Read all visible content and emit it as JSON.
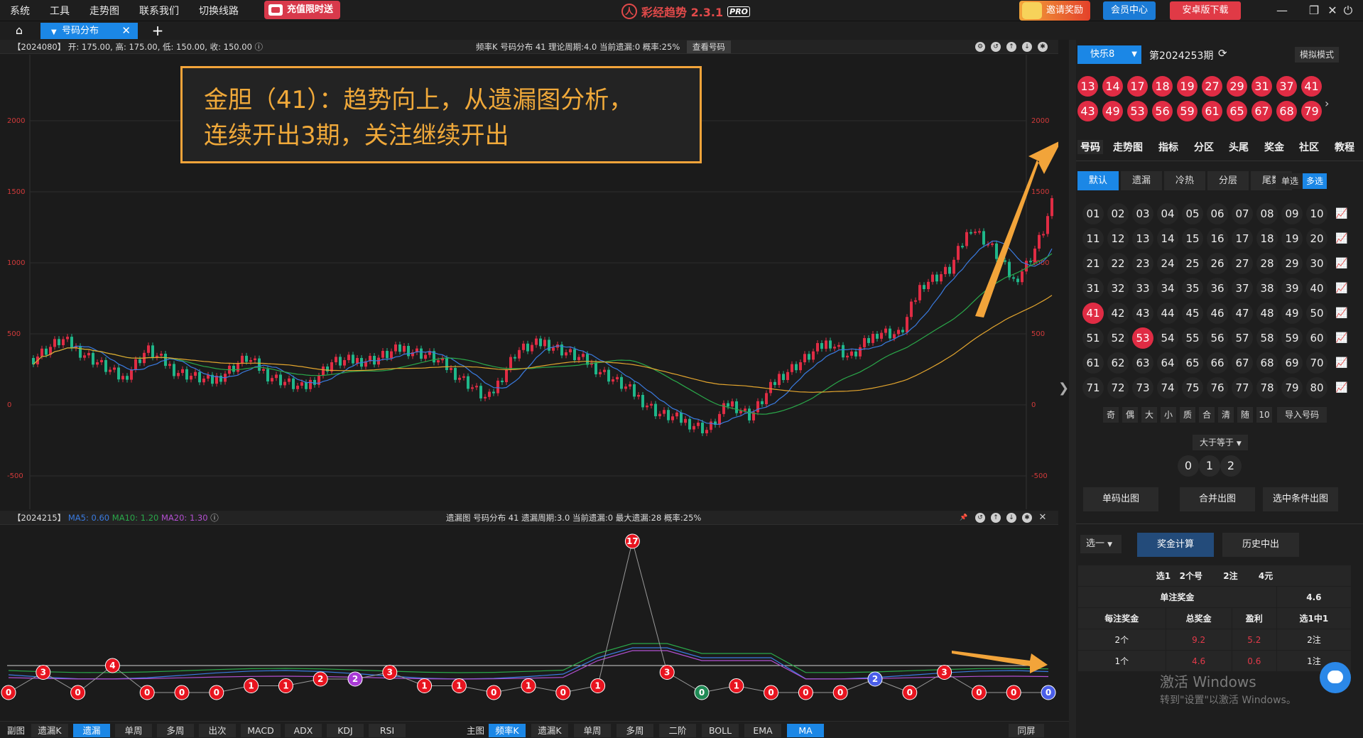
{
  "menu": [
    "系统",
    "工具",
    "走势图",
    "联系我们",
    "切换线路"
  ],
  "promo": "充值限时送",
  "app": {
    "name": "彩经趋势 2.3.1",
    "logo": "人",
    "pro": "PRO"
  },
  "header_buttons": {
    "invite": "邀请奖励",
    "member": "会员中心",
    "android": "安卓版下载"
  },
  "window_controls": {
    "minimize": "—",
    "restore": "❐",
    "close": "✕",
    "power": "⏻"
  },
  "tab": {
    "label": "号码分布",
    "close": "✕",
    "add": "+",
    "home": "⌂"
  },
  "main_chart": {
    "info_left": "【2024080】  开: 175.00, 高: 175.00, 低: 150.00, 收: 150.00  ⓘ",
    "info_center": "频率K  号码分布  41     理论周期:4.0  当前遗漏:0  概率:25%",
    "view_button": "查看号码",
    "y_ticks": [
      "2000",
      "1500",
      "1000",
      "500",
      "0",
      "-500"
    ],
    "annotation": [
      "金胆（41）：趋势向上，从遗漏图分析，",
      "连续开出3期，关注继续开出"
    ],
    "colors": {
      "up": "#e02c44",
      "down": "#1fb78a",
      "ma5": "#3a7be0",
      "ma10": "#2aa84a",
      "ma20": "#e3a52e"
    }
  },
  "miss_chart": {
    "info_left": "【2024215】",
    "ma_labels": [
      "MA5: 0.60",
      "MA10: 1.20",
      "MA20: 1.30"
    ],
    "info_center": "遗漏图  号码分布  41     遗漏周期:3.0  当前遗漏:0  最大遗漏:28  概率:25%",
    "points": [
      0,
      3,
      0,
      4,
      0,
      0,
      0,
      1,
      1,
      2,
      2,
      3,
      1,
      1,
      0,
      1,
      0,
      1,
      17,
      3,
      0,
      1,
      0,
      0,
      0,
      2,
      0,
      3,
      0,
      0,
      0
    ],
    "point_colors": [
      "red",
      "red",
      "red",
      "red",
      "red",
      "red",
      "red",
      "red",
      "red",
      "red",
      "purple",
      "red",
      "red",
      "red",
      "red",
      "red",
      "red",
      "red",
      "red",
      "red",
      "green",
      "red",
      "red",
      "red",
      "red",
      "blue",
      "red",
      "red",
      "red",
      "red",
      "blue"
    ]
  },
  "bottombar": {
    "left_label": "副图",
    "left_items": [
      "遗漏K",
      "遗漏图",
      "单周期",
      "多周期",
      "出次",
      "MACD",
      "ADX",
      "KDJ",
      "RSI"
    ],
    "main_label": "主图",
    "main_items": [
      "频率K",
      "遗漏K",
      "单周期",
      "多周期",
      "二阶",
      "BOLL",
      "EMA",
      "MA"
    ],
    "fullscreen": "同屏"
  },
  "panel": {
    "lottery": "快乐8",
    "issue": "第2024253期",
    "mock": "模拟模式",
    "draw": [
      13,
      14,
      17,
      18,
      19,
      27,
      29,
      31,
      37,
      41,
      43,
      49,
      53,
      56,
      59,
      61,
      65,
      67,
      68,
      79
    ],
    "tabs": [
      "号码",
      "走势图",
      "指标",
      "分区",
      "头尾",
      "奖金",
      "社区",
      "教程"
    ],
    "subtabs": [
      "默认",
      "遗漏",
      "冷热",
      "分层",
      "尾数"
    ],
    "single": "单选",
    "multi": "多选",
    "numbers": [
      "01",
      "02",
      "03",
      "04",
      "05",
      "06",
      "07",
      "08",
      "09",
      "10",
      "11",
      "12",
      "13",
      "14",
      "15",
      "16",
      "17",
      "18",
      "19",
      "20",
      "21",
      "22",
      "23",
      "24",
      "25",
      "26",
      "27",
      "28",
      "29",
      "30",
      "31",
      "32",
      "33",
      "34",
      "35",
      "36",
      "37",
      "38",
      "39",
      "40",
      "41",
      "42",
      "43",
      "44",
      "45",
      "46",
      "47",
      "48",
      "49",
      "50",
      "51",
      "52",
      "53",
      "54",
      "55",
      "56",
      "57",
      "58",
      "59",
      "60",
      "61",
      "62",
      "63",
      "64",
      "65",
      "66",
      "67",
      "68",
      "69",
      "70",
      "71",
      "72",
      "73",
      "74",
      "75",
      "76",
      "77",
      "78",
      "79",
      "80"
    ],
    "selected": [
      "41",
      "53"
    ],
    "filters": [
      "奇",
      "偶",
      "大",
      "小",
      "质",
      "合",
      "清",
      "随",
      "10",
      "导入号码"
    ],
    "compare": "大于等于",
    "counts": [
      "0",
      "1",
      "2"
    ],
    "actions": [
      "单码出图",
      "合并出图",
      "选中条件出图"
    ],
    "pick": "选一",
    "calc": "奖金计算",
    "history": "历史中出",
    "table": {
      "summary": [
        "选1",
        "2个号",
        "2注",
        "4元"
      ],
      "single_prize_label": "单注奖金",
      "single_prize": "4.6",
      "headers": [
        "每注奖金",
        "总奖金",
        "盈利",
        "选1中1"
      ],
      "rows": [
        [
          "2个",
          "9.2",
          "5.2",
          "2注"
        ],
        [
          "1个",
          "4.6",
          "0.6",
          "1注"
        ]
      ]
    },
    "watermark": [
      "激活 Windows",
      "转到\"设置\"以激活 Windows。"
    ]
  }
}
